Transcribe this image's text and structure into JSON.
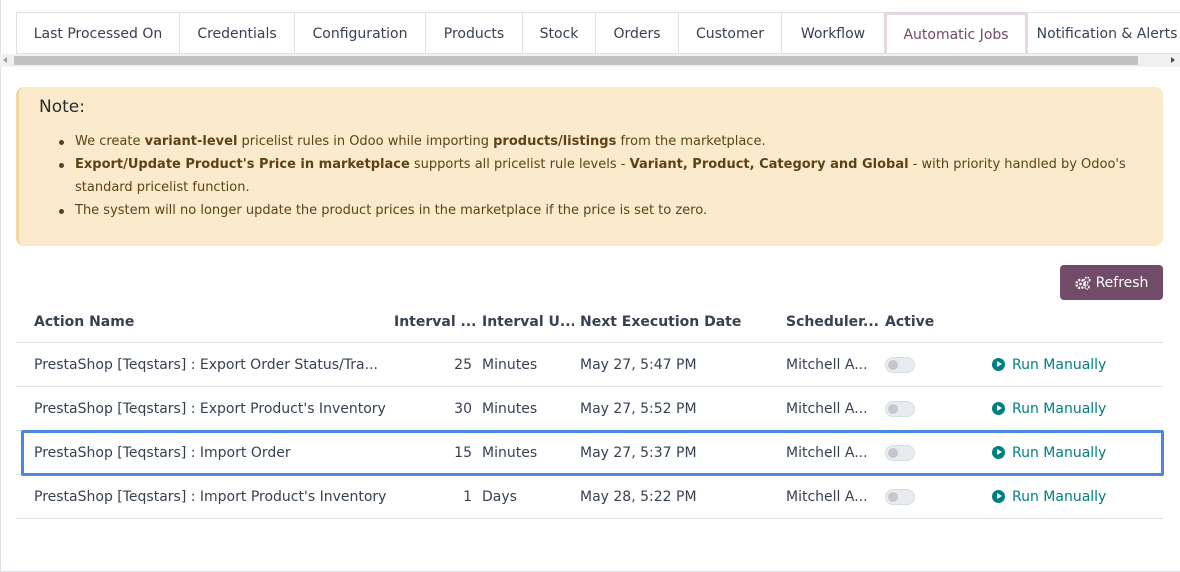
{
  "tabs": [
    {
      "label": "Last Processed On",
      "active": false
    },
    {
      "label": "Credentials",
      "active": false
    },
    {
      "label": "Configuration",
      "active": false
    },
    {
      "label": "Products",
      "active": false
    },
    {
      "label": "Stock",
      "active": false
    },
    {
      "label": "Orders",
      "active": false
    },
    {
      "label": "Customer",
      "active": false
    },
    {
      "label": "Workflow",
      "active": false
    },
    {
      "label": "Automatic Jobs",
      "active": true
    },
    {
      "label": "Notification & Alerts",
      "active": false
    }
  ],
  "note": {
    "title": "Note:",
    "items": [
      {
        "parts": [
          {
            "text": "We create ",
            "bold": false
          },
          {
            "text": "variant-level",
            "bold": true
          },
          {
            "text": " pricelist rules in Odoo while importing ",
            "bold": false
          },
          {
            "text": "products/listings",
            "bold": true
          },
          {
            "text": " from the marketplace.",
            "bold": false
          }
        ]
      },
      {
        "parts": [
          {
            "text": "Export/Update Product's Price in marketplace",
            "bold": true
          },
          {
            "text": " supports all pricelist rule levels - ",
            "bold": false
          },
          {
            "text": "Variant, Product, Category and Global",
            "bold": true
          },
          {
            "text": " - with priority handled by Odoo's standard pricelist function.",
            "bold": false
          }
        ]
      },
      {
        "parts": [
          {
            "text": "The system will no longer update the product prices in the marketplace if the price is set to zero.",
            "bold": false
          }
        ]
      }
    ]
  },
  "refresh_label": "Refresh",
  "table": {
    "headers": {
      "action_name": "Action Name",
      "interval": "Interval ...",
      "interval_unit": "Interval U...",
      "next_execution": "Next Execution Date",
      "scheduler": "Scheduler...",
      "active": "Active"
    },
    "rows": [
      {
        "name": "PrestaShop [Teqstars] : Export Order Status/Tra...",
        "interval": "25",
        "unit": "Minutes",
        "next": "May 27, 5:47 PM",
        "scheduler": "Mitchell A...",
        "active": false,
        "run_label": "Run Manually",
        "highlighted": false
      },
      {
        "name": "PrestaShop [Teqstars] : Export Product's Inventory",
        "interval": "30",
        "unit": "Minutes",
        "next": "May 27, 5:52 PM",
        "scheduler": "Mitchell A...",
        "active": false,
        "run_label": "Run Manually",
        "highlighted": false
      },
      {
        "name": "PrestaShop [Teqstars] : Import Order",
        "interval": "15",
        "unit": "Minutes",
        "next": "May 27, 5:37 PM",
        "scheduler": "Mitchell A...",
        "active": false,
        "run_label": "Run Manually",
        "highlighted": true
      },
      {
        "name": "PrestaShop [Teqstars] : Import Product's Inventory",
        "interval": "1",
        "unit": "Days",
        "next": "May 28, 5:22 PM",
        "scheduler": "Mitchell A...",
        "active": false,
        "run_label": "Run Manually",
        "highlighted": false
      }
    ]
  },
  "colors": {
    "brand": "#714b67",
    "link": "#017e84",
    "note_bg": "#fbeacb",
    "highlight": "#4a88e0"
  }
}
